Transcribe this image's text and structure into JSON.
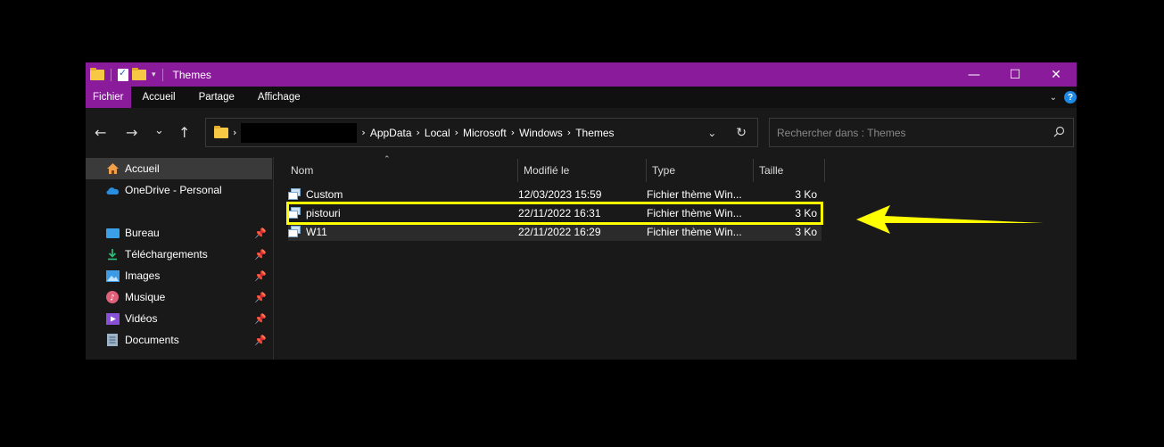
{
  "window": {
    "title": "Themes",
    "controls": {
      "minimize": "—",
      "maximize": "☐",
      "close": "✕"
    }
  },
  "ribbon": {
    "tabs": [
      "Fichier",
      "Accueil",
      "Partage",
      "Affichage"
    ],
    "active_tab": "Fichier"
  },
  "navigation": {
    "back": "←",
    "forward": "→",
    "recent": "⌄",
    "up": "↑",
    "breadcrumbs": [
      "AppData",
      "Local",
      "Microsoft",
      "Windows",
      "Themes"
    ],
    "search_placeholder": "Rechercher dans : Themes"
  },
  "sidebar": {
    "items": [
      {
        "label": "Accueil",
        "icon": "home-icon",
        "pinned": false
      },
      {
        "label": "OneDrive - Personal",
        "icon": "cloud-icon",
        "pinned": false
      },
      {
        "label": "Bureau",
        "icon": "desktop-icon",
        "pinned": true
      },
      {
        "label": "Téléchargements",
        "icon": "download-icon",
        "pinned": true
      },
      {
        "label": "Images",
        "icon": "images-icon",
        "pinned": true
      },
      {
        "label": "Musique",
        "icon": "music-icon",
        "pinned": true
      },
      {
        "label": "Vidéos",
        "icon": "videos-icon",
        "pinned": true
      },
      {
        "label": "Documents",
        "icon": "documents-icon",
        "pinned": true
      }
    ]
  },
  "filelist": {
    "columns": [
      "Nom",
      "Modifié le",
      "Type",
      "Taille"
    ],
    "rows": [
      {
        "name": "Custom",
        "modified": "12/03/2023 15:59",
        "type": "Fichier thème Win...",
        "size": "3 Ko"
      },
      {
        "name": "pistouri",
        "modified": "22/11/2022 16:31",
        "type": "Fichier thème Win...",
        "size": "3 Ko"
      },
      {
        "name": "W11",
        "modified": "22/11/2022 16:29",
        "type": "Fichier thème Win...",
        "size": "3 Ko"
      }
    ]
  },
  "annotation": {
    "highlight_color": "#ffff00",
    "arrow_color": "#ffff00"
  },
  "colors": {
    "accent": "#8a1c9c",
    "background": "#191919"
  }
}
